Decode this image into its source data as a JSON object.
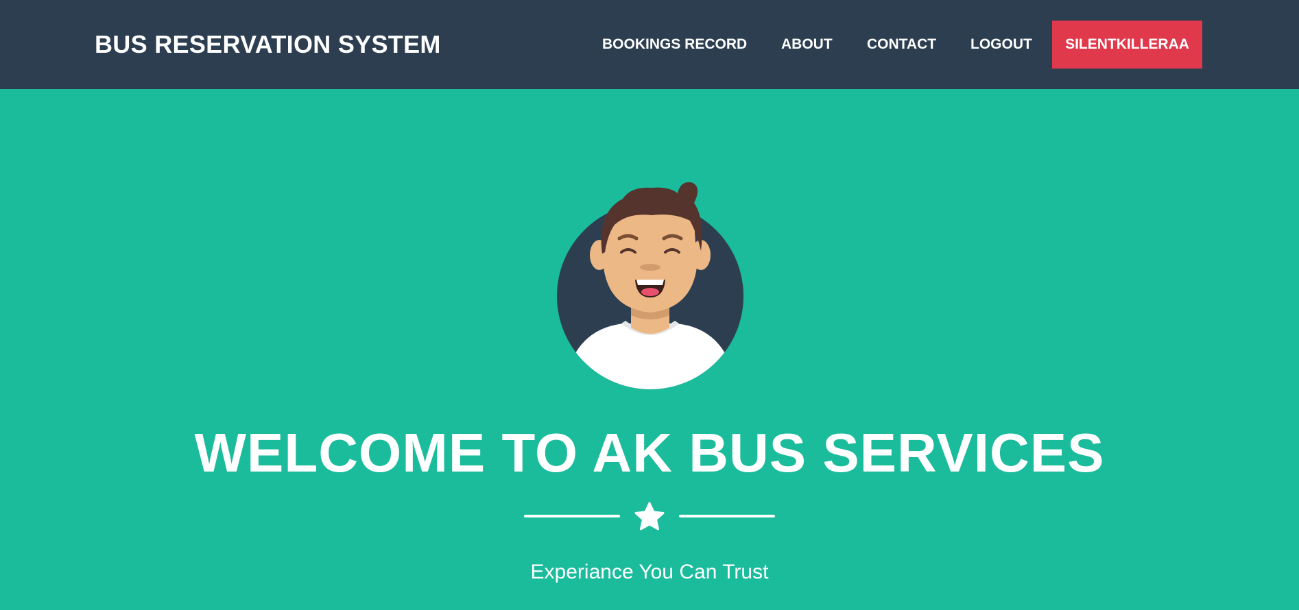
{
  "navbar": {
    "brand": "BUS RESERVATION SYSTEM",
    "links": [
      {
        "label": "BOOKINGS RECORD"
      },
      {
        "label": "ABOUT"
      },
      {
        "label": "CONTACT"
      },
      {
        "label": "LOGOUT"
      }
    ],
    "user_button": "SILENTKILLERAA"
  },
  "hero": {
    "avatar_icon": "smiling-man-avatar",
    "title": "WELCOME TO AK BUS SERVICES",
    "divider_icon": "star-icon",
    "subtitle": "Experiance You Can Trust"
  },
  "colors": {
    "navbar_bg": "#2c3e50",
    "hero_bg": "#1abc9c",
    "user_button_bg": "#e0394c",
    "text": "#ffffff"
  }
}
